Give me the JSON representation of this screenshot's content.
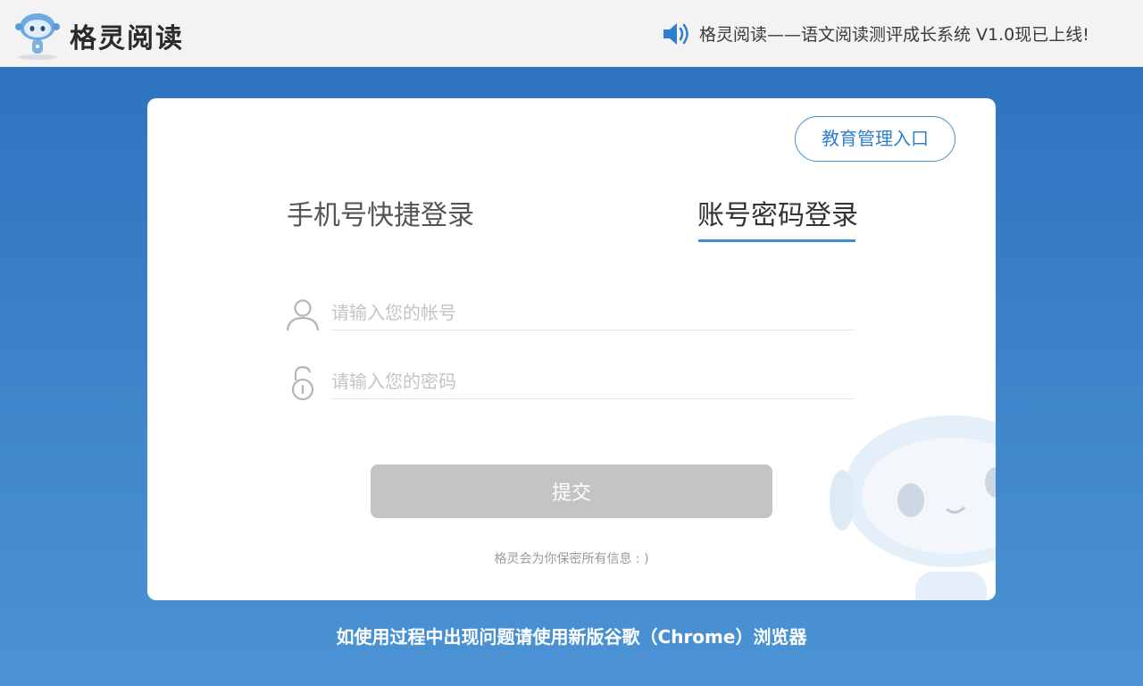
{
  "header": {
    "brand": "格灵阅读",
    "announcement": "格灵阅读——语文阅读测评成长系统 V1.0现已上线!",
    "logo_icon": "robot-mascot-icon",
    "announcement_icon": "speaker-icon"
  },
  "card": {
    "edu_entry_label": "教育管理入口",
    "tabs": [
      {
        "label": "手机号快捷登录",
        "active": false
      },
      {
        "label": "账号密码登录",
        "active": true
      }
    ],
    "account_field": {
      "placeholder": "请输入您的帐号",
      "value": "",
      "icon": "user-icon"
    },
    "password_field": {
      "placeholder": "请输入您的密码",
      "value": "",
      "icon": "lock-icon"
    },
    "submit_label": "提交",
    "privacy_note": "格灵会为你保密所有信息 : )"
  },
  "footer": {
    "browser_tip": "如使用过程中出现问题请使用新版谷歌（Chrome）浏览器"
  },
  "colors": {
    "accent": "#3f8fd6",
    "background_top": "#2a6fbd",
    "background_bottom": "#4b93d4",
    "submit_disabled": "#c4c4c4"
  }
}
